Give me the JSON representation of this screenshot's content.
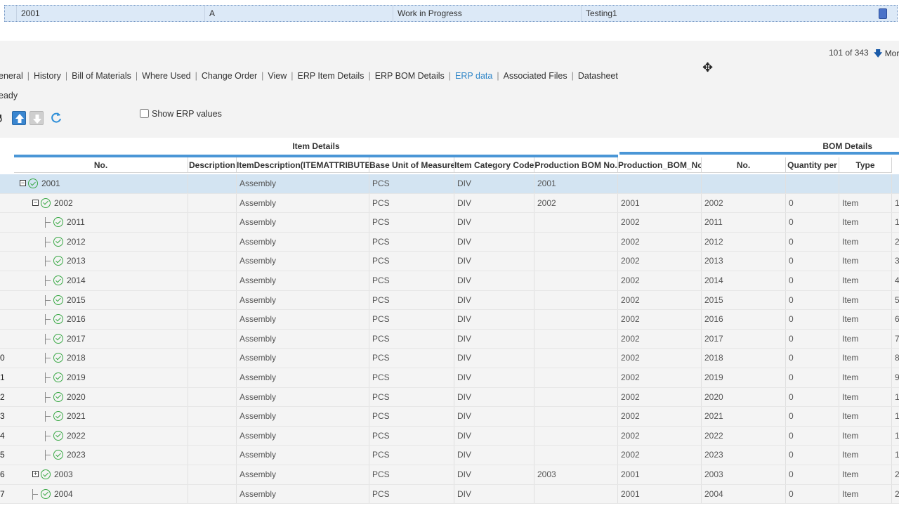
{
  "selected_record": {
    "number": "2001",
    "revision": "A",
    "lifecycle": "Work in Progress",
    "description": "Testing1",
    "flag_color": "#4a72c8"
  },
  "pager": {
    "position": "101 of 343",
    "more_label": "Mor"
  },
  "tabs": [
    {
      "label": "eneral",
      "active": false
    },
    {
      "label": "History",
      "active": false
    },
    {
      "label": "Bill of Materials",
      "active": false
    },
    {
      "label": "Where Used",
      "active": false
    },
    {
      "label": "Change Order",
      "active": false
    },
    {
      "label": "View",
      "active": false
    },
    {
      "label": "ERP Item Details",
      "active": false
    },
    {
      "label": "ERP BOM Details",
      "active": false
    },
    {
      "label": "ERP data",
      "active": true
    },
    {
      "label": "Associated Files",
      "active": false
    },
    {
      "label": "Datasheet",
      "active": false
    }
  ],
  "status_text": "eady",
  "toolbar": {
    "show_erp_label": "Show ERP values",
    "show_erp_checked": false
  },
  "groups": {
    "item_details": "Item Details",
    "bom_details": "BOM Details"
  },
  "columns": [
    "No.",
    "Description",
    "ItemDescription(ITEMATTRIBUTE)",
    "Base Unit of Measure",
    "Item Category Code",
    "Production BOM No.",
    "Production_BOM_No",
    "No.",
    "Quantity per",
    "Type"
  ],
  "rows": [
    {
      "rownum": "",
      "no": "2001",
      "desc": "",
      "itemdesc": "Assembly",
      "uom": "PCS",
      "cat": "DIV",
      "pbom": "2001",
      "pbom2": "",
      "bomno": "",
      "qty": "",
      "type": "",
      "extra": ""
    },
    {
      "rownum": "",
      "no": "2002",
      "desc": "",
      "itemdesc": "Assembly",
      "uom": "PCS",
      "cat": "DIV",
      "pbom": "2002",
      "pbom2": "2001",
      "bomno": "2002",
      "qty": "0",
      "type": "Item",
      "extra": "1"
    },
    {
      "rownum": "",
      "no": "2011",
      "desc": "",
      "itemdesc": "Assembly",
      "uom": "PCS",
      "cat": "DIV",
      "pbom": "",
      "pbom2": "2002",
      "bomno": "2011",
      "qty": "0",
      "type": "Item",
      "extra": "1"
    },
    {
      "rownum": "",
      "no": "2012",
      "desc": "",
      "itemdesc": "Assembly",
      "uom": "PCS",
      "cat": "DIV",
      "pbom": "",
      "pbom2": "2002",
      "bomno": "2012",
      "qty": "0",
      "type": "Item",
      "extra": "2"
    },
    {
      "rownum": "",
      "no": "2013",
      "desc": "",
      "itemdesc": "Assembly",
      "uom": "PCS",
      "cat": "DIV",
      "pbom": "",
      "pbom2": "2002",
      "bomno": "2013",
      "qty": "0",
      "type": "Item",
      "extra": "3"
    },
    {
      "rownum": "",
      "no": "2014",
      "desc": "",
      "itemdesc": "Assembly",
      "uom": "PCS",
      "cat": "DIV",
      "pbom": "",
      "pbom2": "2002",
      "bomno": "2014",
      "qty": "0",
      "type": "Item",
      "extra": "4"
    },
    {
      "rownum": "",
      "no": "2015",
      "desc": "",
      "itemdesc": "Assembly",
      "uom": "PCS",
      "cat": "DIV",
      "pbom": "",
      "pbom2": "2002",
      "bomno": "2015",
      "qty": "0",
      "type": "Item",
      "extra": "5"
    },
    {
      "rownum": "",
      "no": "2016",
      "desc": "",
      "itemdesc": "Assembly",
      "uom": "PCS",
      "cat": "DIV",
      "pbom": "",
      "pbom2": "2002",
      "bomno": "2016",
      "qty": "0",
      "type": "Item",
      "extra": "6"
    },
    {
      "rownum": "",
      "no": "2017",
      "desc": "",
      "itemdesc": "Assembly",
      "uom": "PCS",
      "cat": "DIV",
      "pbom": "",
      "pbom2": "2002",
      "bomno": "2017",
      "qty": "0",
      "type": "Item",
      "extra": "7"
    },
    {
      "rownum": "0",
      "no": "2018",
      "desc": "",
      "itemdesc": "Assembly",
      "uom": "PCS",
      "cat": "DIV",
      "pbom": "",
      "pbom2": "2002",
      "bomno": "2018",
      "qty": "0",
      "type": "Item",
      "extra": "8"
    },
    {
      "rownum": "1",
      "no": "2019",
      "desc": "",
      "itemdesc": "Assembly",
      "uom": "PCS",
      "cat": "DIV",
      "pbom": "",
      "pbom2": "2002",
      "bomno": "2019",
      "qty": "0",
      "type": "Item",
      "extra": "9"
    },
    {
      "rownum": "2",
      "no": "2020",
      "desc": "",
      "itemdesc": "Assembly",
      "uom": "PCS",
      "cat": "DIV",
      "pbom": "",
      "pbom2": "2002",
      "bomno": "2020",
      "qty": "0",
      "type": "Item",
      "extra": "1"
    },
    {
      "rownum": "3",
      "no": "2021",
      "desc": "",
      "itemdesc": "Assembly",
      "uom": "PCS",
      "cat": "DIV",
      "pbom": "",
      "pbom2": "2002",
      "bomno": "2021",
      "qty": "0",
      "type": "Item",
      "extra": "1"
    },
    {
      "rownum": "4",
      "no": "2022",
      "desc": "",
      "itemdesc": "Assembly",
      "uom": "PCS",
      "cat": "DIV",
      "pbom": "",
      "pbom2": "2002",
      "bomno": "2022",
      "qty": "0",
      "type": "Item",
      "extra": "1"
    },
    {
      "rownum": "5",
      "no": "2023",
      "desc": "",
      "itemdesc": "Assembly",
      "uom": "PCS",
      "cat": "DIV",
      "pbom": "",
      "pbom2": "2002",
      "bomno": "2023",
      "qty": "0",
      "type": "Item",
      "extra": "1"
    },
    {
      "rownum": "6",
      "no": "2003",
      "desc": "",
      "itemdesc": "Assembly",
      "uom": "PCS",
      "cat": "DIV",
      "pbom": "2003",
      "pbom2": "2001",
      "bomno": "2003",
      "qty": "0",
      "type": "Item",
      "extra": "2"
    },
    {
      "rownum": "7",
      "no": "2004",
      "desc": "",
      "itemdesc": "Assembly",
      "uom": "PCS",
      "cat": "DIV",
      "pbom": "",
      "pbom2": "2001",
      "bomno": "2004",
      "qty": "0",
      "type": "Item",
      "extra": "2"
    }
  ]
}
